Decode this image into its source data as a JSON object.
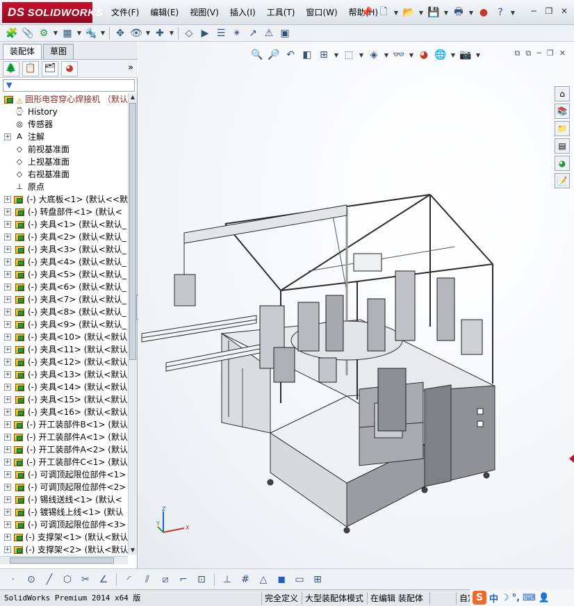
{
  "app": {
    "logo_text": "SOLIDWORKS",
    "logo_ds": "DS"
  },
  "menu": [
    "文件(F)",
    "编辑(E)",
    "视图(V)",
    "插入(I)",
    "工具(T)",
    "窗口(W)",
    "帮助(H)"
  ],
  "tabs": {
    "assembly": "装配体",
    "sketch": "草图"
  },
  "tree": {
    "root": "圆形电容穿心焊接机 （默认",
    "fixed_items": [
      {
        "icon": "history-icon",
        "label": "History"
      },
      {
        "icon": "sensor-icon",
        "label": "传感器"
      },
      {
        "icon": "annotation-icon",
        "label": "注解",
        "expandable": true
      },
      {
        "icon": "plane-icon",
        "label": "前视基准面"
      },
      {
        "icon": "plane-icon",
        "label": "上视基准面"
      },
      {
        "icon": "plane-icon",
        "label": "右视基准面"
      },
      {
        "icon": "origin-icon",
        "label": "原点"
      }
    ],
    "components": [
      "(-) 大底板<1> (默认<<默",
      "(-) 转盘部件<1> (默认<",
      "(-) 夹具<1> (默认<默认_",
      "(-) 夹具<2> (默认<默认_",
      "(-) 夹具<3> (默认<默认_",
      "(-) 夹具<4> (默认<默认_",
      "(-) 夹具<5> (默认<默认_",
      "(-) 夹具<6> (默认<默认_",
      "(-) 夹具<7> (默认<默认_",
      "(-) 夹具<8> (默认<默认_",
      "(-) 夹具<9> (默认<默认_",
      "(-) 夹具<10> (默认<默认",
      "(-) 夹具<11> (默认<默认",
      "(-) 夹具<12> (默认<默认",
      "(-) 夹具<13> (默认<默认",
      "(-) 夹具<14> (默认<默认",
      "(-) 夹具<15> (默认<默认",
      "(-) 夹具<16> (默认<默认",
      "(-) 开工装部件B<1> (默认",
      "(-) 开工装部件A<1> (默认",
      "(-) 开工装部件A<2> (默认",
      "(-) 开工装部件C<1> (默认",
      "(-) 可调顶起限位部件<1>",
      "(-) 可调顶起限位部件<2>",
      "(-) 锡线送线<1> (默认<",
      "(-) 镀锡线上线<1> (默认",
      "(-) 可调顶起限位部件<3>",
      "(-) 支撑架<1> (默认<默认",
      "(-) 支撑架<2> (默认<默认"
    ]
  },
  "triad": {
    "x": "X",
    "y": "Y",
    "z": "Z"
  },
  "status": {
    "product": "SolidWorks Premium 2014 x64 版",
    "definition": "完全定义",
    "mode": "大型装配体模式",
    "editing": "在编辑 装配体",
    "custom": "自定义"
  },
  "ime": {
    "s": "S",
    "lang": "中"
  }
}
